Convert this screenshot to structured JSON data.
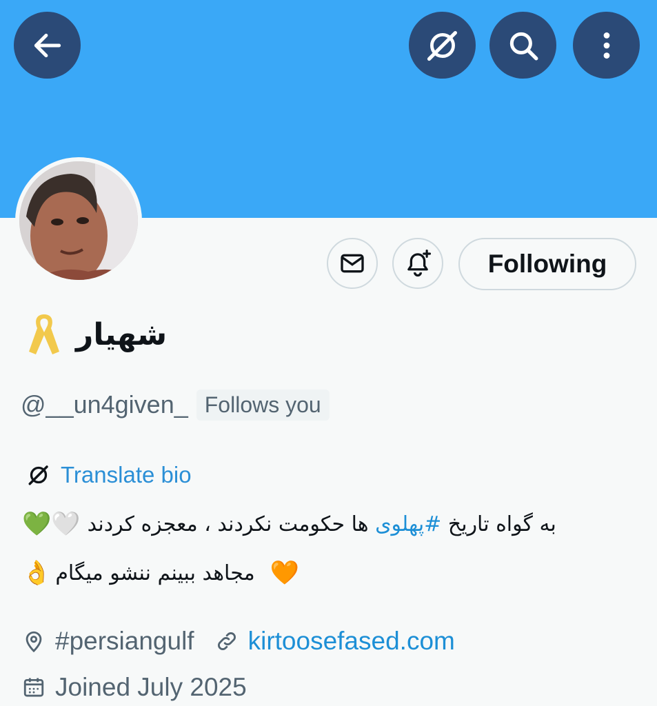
{
  "header": {
    "back_icon": "arrow-left-icon",
    "grok_icon": "grok-icon",
    "search_icon": "search-icon",
    "more_icon": "more-vertical-icon",
    "banner_color": "#3aa8f7"
  },
  "actions": {
    "message_icon": "mail-icon",
    "notify_icon": "bell-plus-icon",
    "follow_label": "Following"
  },
  "profile": {
    "display_name": "شهیار",
    "ribbon_icon": "yellow-ribbon-emoji",
    "handle": "@__un4given_",
    "follows_you": "Follows you"
  },
  "bio": {
    "translate_label": "Translate bio",
    "line1_before": "به گواه تاریخ ",
    "line1_hashtag": "#پهلوی",
    "line1_after": " ها حکومت نکردند ، معجزه کردند",
    "line1_emojis": "💚🤍",
    "line2_text": "مجاهد ببینم ننشو میگام",
    "line2_emoji_left": "👌",
    "line2_emoji_right": "🧡"
  },
  "meta": {
    "location_icon": "location-pin-icon",
    "location": "#persiangulf",
    "link_icon": "link-icon",
    "website": "kirtoosefased.com",
    "calendar_icon": "calendar-icon",
    "joined": "Joined July 2025"
  }
}
